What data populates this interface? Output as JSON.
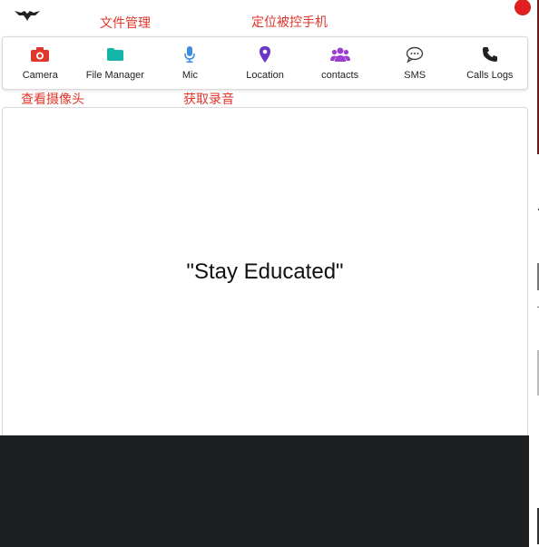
{
  "header": {
    "logo_icon": "bird-logo-icon",
    "status_color": "#e02020"
  },
  "annotations": {
    "file_manager": "文件管理",
    "location": "定位被控手机",
    "camera": "查看摄像头",
    "mic": "获取录音"
  },
  "toolbar": {
    "items": [
      {
        "label": "Camera",
        "icon": "camera-icon",
        "color": "#e0362c"
      },
      {
        "label": "File Manager",
        "icon": "folder-icon",
        "color": "#13b5a6"
      },
      {
        "label": "Mic",
        "icon": "microphone-icon",
        "color": "#3f8de0"
      },
      {
        "label": "Location",
        "icon": "map-pin-icon",
        "color": "#6a35c8"
      },
      {
        "label": "contacts",
        "icon": "users-icon",
        "color": "#9b3ed1"
      },
      {
        "label": "SMS",
        "icon": "chat-bubble-icon",
        "color": "#444444"
      },
      {
        "label": "Calls Logs",
        "icon": "phone-icon",
        "color": "#222222"
      }
    ]
  },
  "main": {
    "quote": "\"Stay Educated\""
  },
  "footer": {
    "background": "#1e1f21"
  }
}
